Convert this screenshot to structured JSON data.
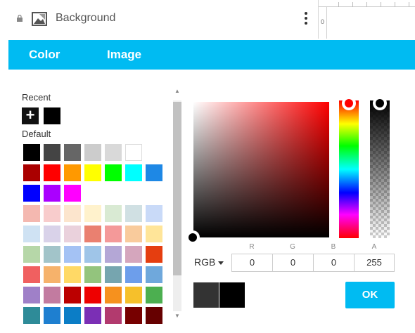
{
  "layer": {
    "name": "Background"
  },
  "ruler": {
    "origin_label": "0"
  },
  "tabs": [
    {
      "label": "Color"
    },
    {
      "label": "Image"
    }
  ],
  "palette": {
    "recent_label": "Recent",
    "add_symbol": "+",
    "recent_colors": [
      "#000000"
    ],
    "default_label": "Default",
    "default_colors": [
      [
        "#000000",
        "#444444",
        "#666666",
        "#cccccc",
        "#d9d9d9",
        "#ffffff"
      ],
      [
        "#aa0000",
        "#ff0000",
        "#ff9900",
        "#ffff00",
        "#00ff00",
        "#00ffff",
        "#1e88e5"
      ],
      [
        "#0000ff",
        "#aa00ff",
        "#ff00ff"
      ],
      [
        "#f4b8b0",
        "#f8cccc",
        "#fce5cd",
        "#fff2cc",
        "#d9ead3",
        "#d0e0e3",
        "#c9daf8"
      ],
      [
        "#cfe2f3",
        "#d9d2e9",
        "#ead1dc",
        "#ea8070",
        "#f49999",
        "#f9cb9c",
        "#ffe599"
      ],
      [
        "#b6d7a8",
        "#a2c4c9",
        "#a4c2f4",
        "#9fc5e8",
        "#b4a7d6",
        "#d5a6bd",
        "#e53e10"
      ],
      [
        "#f06060",
        "#f6b26b",
        "#ffd966",
        "#93c47d",
        "#76a5af",
        "#6d9eeb",
        "#6fa8dc"
      ],
      [
        "#9f80c8",
        "#c27ba0",
        "#bb0000",
        "#ee0000",
        "#f6911e",
        "#f6c02b",
        "#4caf50"
      ],
      [
        "#2e8b98",
        "#1e7fd0",
        "#0b7dc6",
        "#7b2fb5",
        "#b23a6e",
        "#770000",
        "#660000"
      ]
    ]
  },
  "picker": {
    "mode": "RGB",
    "channels": [
      {
        "label": "R",
        "value": "0"
      },
      {
        "label": "G",
        "value": "0"
      },
      {
        "label": "B",
        "value": "0"
      },
      {
        "label": "A",
        "value": "255"
      }
    ],
    "hue_color": "#ff0000",
    "previous_color": "#333333",
    "current_color": "#000000",
    "ok_label": "OK"
  },
  "colors": {
    "accent": "#00bbf2"
  }
}
